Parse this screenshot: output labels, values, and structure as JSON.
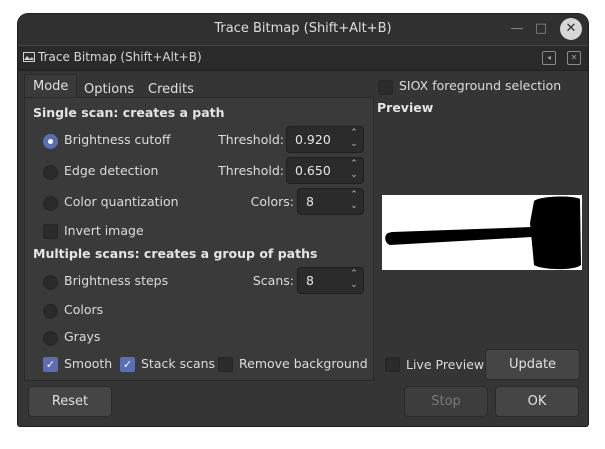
{
  "window": {
    "title": "Trace Bitmap (Shift+Alt+B)",
    "minimize": "—",
    "maximize": "□",
    "close": "✕"
  },
  "dock": {
    "title": "Trace Bitmap (Shift+Alt+B)",
    "btn_a": "◂",
    "btn_b": "✕"
  },
  "tabs": [
    {
      "label": "Mode"
    },
    {
      "label": "Options"
    },
    {
      "label": "Credits"
    }
  ],
  "single": {
    "heading": "Single scan: creates a path",
    "brightness": {
      "label": "Brightness cutoff",
      "field_label": "Threshold:",
      "value": "0.920",
      "selected": true
    },
    "edge": {
      "label": "Edge detection",
      "field_label": "Threshold:",
      "value": "0.650"
    },
    "colorq": {
      "label": "Color quantization",
      "field_label": "Colors:",
      "value": "8"
    },
    "invert": {
      "label": "Invert image",
      "checked": false
    }
  },
  "multi": {
    "heading": "Multiple scans: creates a group of paths",
    "steps": {
      "label": "Brightness steps",
      "field_label": "Scans:",
      "value": "8"
    },
    "colors": {
      "label": "Colors"
    },
    "grays": {
      "label": "Grays"
    }
  },
  "options": {
    "smooth": {
      "label": "Smooth",
      "checked": true
    },
    "stack": {
      "label": "Stack scans",
      "checked": true
    },
    "remove_bg": {
      "label": "Remove background",
      "checked": false
    }
  },
  "siox": {
    "label": "SIOX foreground selection",
    "checked": false
  },
  "preview": {
    "heading": "Preview"
  },
  "live_preview": {
    "label": "Live Preview",
    "checked": false
  },
  "buttons": {
    "update": "Update",
    "reset": "Reset",
    "stop": "Stop",
    "ok": "OK"
  },
  "colors": {
    "accent": "#5b6eb5",
    "background": "#353535",
    "field": "#2b2b2b"
  },
  "spin_arrows": {
    "up": "⌃",
    "down": "⌄"
  }
}
